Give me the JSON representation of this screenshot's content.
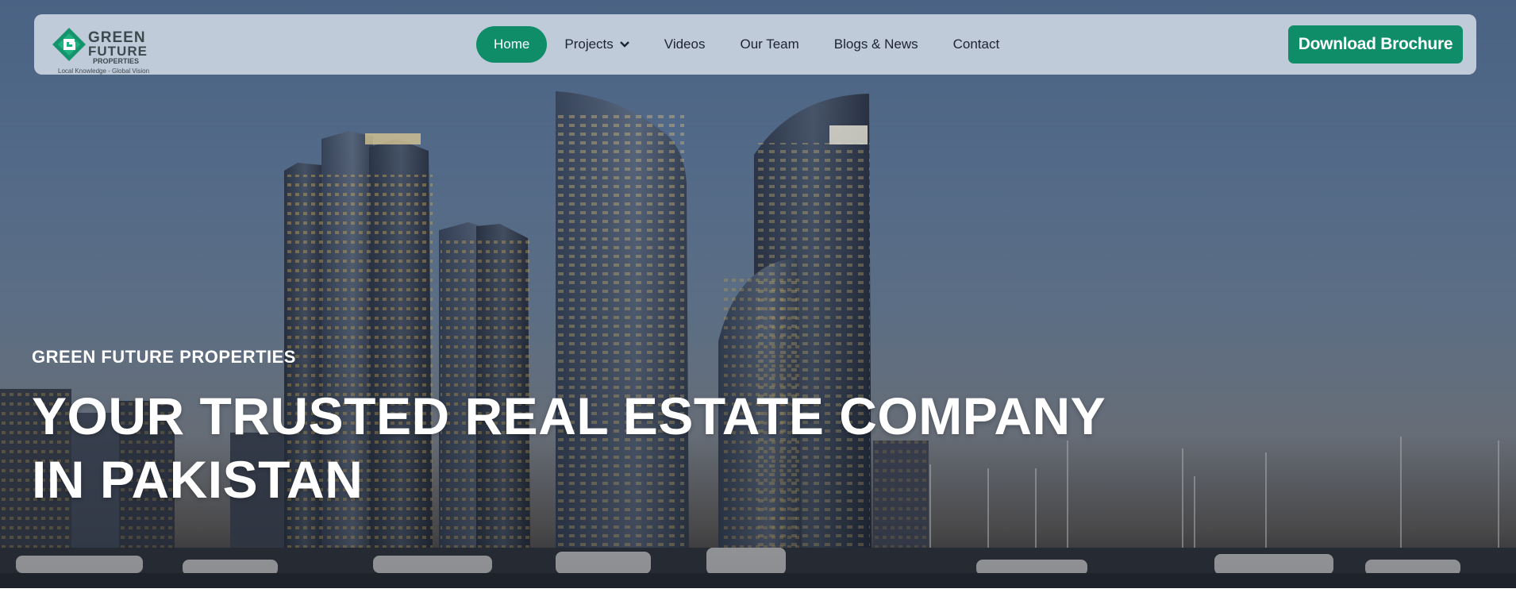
{
  "brand": {
    "line1": "GREEN",
    "line2": "FUTURE",
    "line3": "PROPERTIES",
    "tagline": "Local Knowledge - Global Vision",
    "logo_icon": "gf-diamond-logo-icon"
  },
  "nav": {
    "items": [
      {
        "label": "Home",
        "active": true
      },
      {
        "label": "Projects",
        "has_dropdown": true
      },
      {
        "label": "Videos"
      },
      {
        "label": "Our Team"
      },
      {
        "label": "Blogs & News"
      },
      {
        "label": "Contact"
      }
    ],
    "cta_label": "Download Brochure"
  },
  "hero": {
    "eyebrow": "GREEN FUTURE PROPERTIES",
    "headline_line1": "YOUR TRUSTED REAL ESTATE COMPANY",
    "headline_line2": "IN PAKISTAN"
  },
  "colors": {
    "accent": "#0f8c68",
    "navbar_bg": "#cdd6e2",
    "text_dark": "#1d2430",
    "hero_text": "#ffffff"
  }
}
